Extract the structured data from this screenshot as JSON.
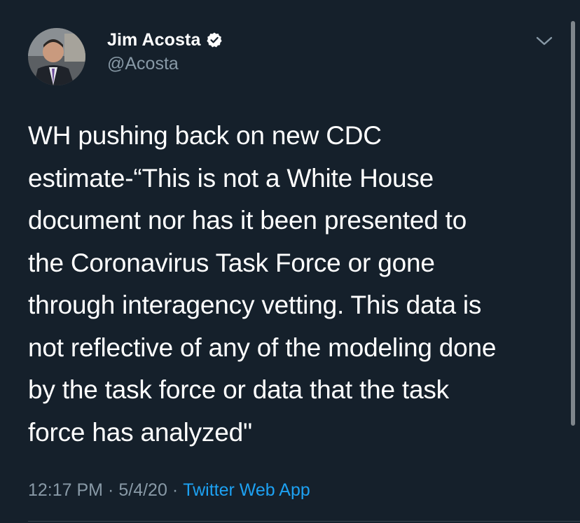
{
  "author": {
    "display_name": "Jim Acosta",
    "handle": "@Acosta",
    "verified_icon": "verified-badge-icon",
    "avatar_description_icon": "avatar"
  },
  "tweet": {
    "text": "WH pushing back on new CDC\nestimate-“This is not a White House\ndocument nor has it been presented to\nthe Coronavirus Task Force or gone\nthrough interagency vetting. This data is\nnot reflective of any of the modeling done\nby the task force or data that the task\nforce has analyzed\"",
    "time": "12:17 PM",
    "separator": "·",
    "date": "5/4/20",
    "source": "Twitter Web App"
  },
  "menu": {
    "icon": "chevron-down-icon"
  },
  "colors": {
    "background": "#15202b",
    "primary_text": "#ffffff",
    "secondary_text": "#8899a6",
    "accent": "#1da1f2"
  }
}
